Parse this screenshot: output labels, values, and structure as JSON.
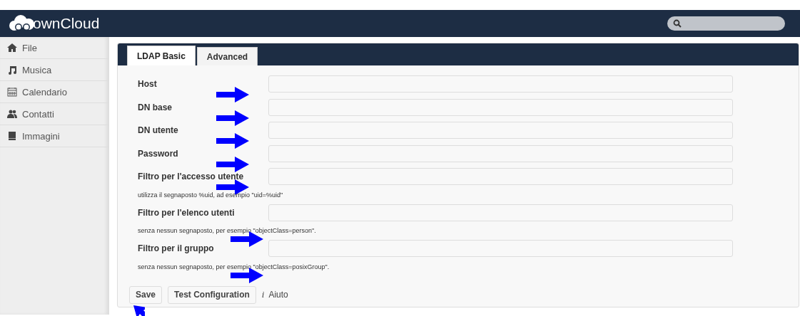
{
  "header": {
    "logo_text": "ownCloud"
  },
  "sidebar": {
    "items": [
      {
        "label": "File",
        "selected": false
      },
      {
        "label": "Musica",
        "selected": false
      },
      {
        "label": "Calendario",
        "selected": false
      },
      {
        "label": "Contatti",
        "selected": false
      },
      {
        "label": "Immagini",
        "selected": false
      }
    ]
  },
  "tabs": [
    {
      "label": "LDAP Basic",
      "selected": true
    },
    {
      "label": "Advanced",
      "selected": false
    }
  ],
  "form": [
    {
      "kind": "field",
      "label": "Host",
      "arrow": true
    },
    {
      "kind": "field",
      "label": "DN base",
      "arrow": true
    },
    {
      "kind": "field",
      "label": "DN utente",
      "arrow": true
    },
    {
      "kind": "field",
      "label": "Password",
      "arrow": true
    },
    {
      "kind": "field",
      "label": "Filtro per l'accesso utente",
      "arrow": true
    },
    {
      "kind": "hint",
      "text": "utilizza il segnaposto %uid, ad esempio \"uid=%uid\"",
      "arrow": false
    },
    {
      "kind": "field",
      "label": "Filtro per l'elenco utenti",
      "arrow": false
    },
    {
      "kind": "hint",
      "text": "senza nessun segnaposto, per esempio \"objectClass=person\".",
      "arrow": true
    },
    {
      "kind": "field",
      "label": "Filtro per il gruppo",
      "arrow": false
    },
    {
      "kind": "hint",
      "text": "senza nessun segnaposto, per esempio \"objectClass=posixGroup\".",
      "arrow": true
    }
  ],
  "buttons": [
    {
      "label": "Save",
      "arrow": true
    },
    {
      "label": "Test Configuration",
      "arrow": false
    }
  ],
  "help": {
    "icon_text": "i",
    "label": "Aiuto"
  }
}
